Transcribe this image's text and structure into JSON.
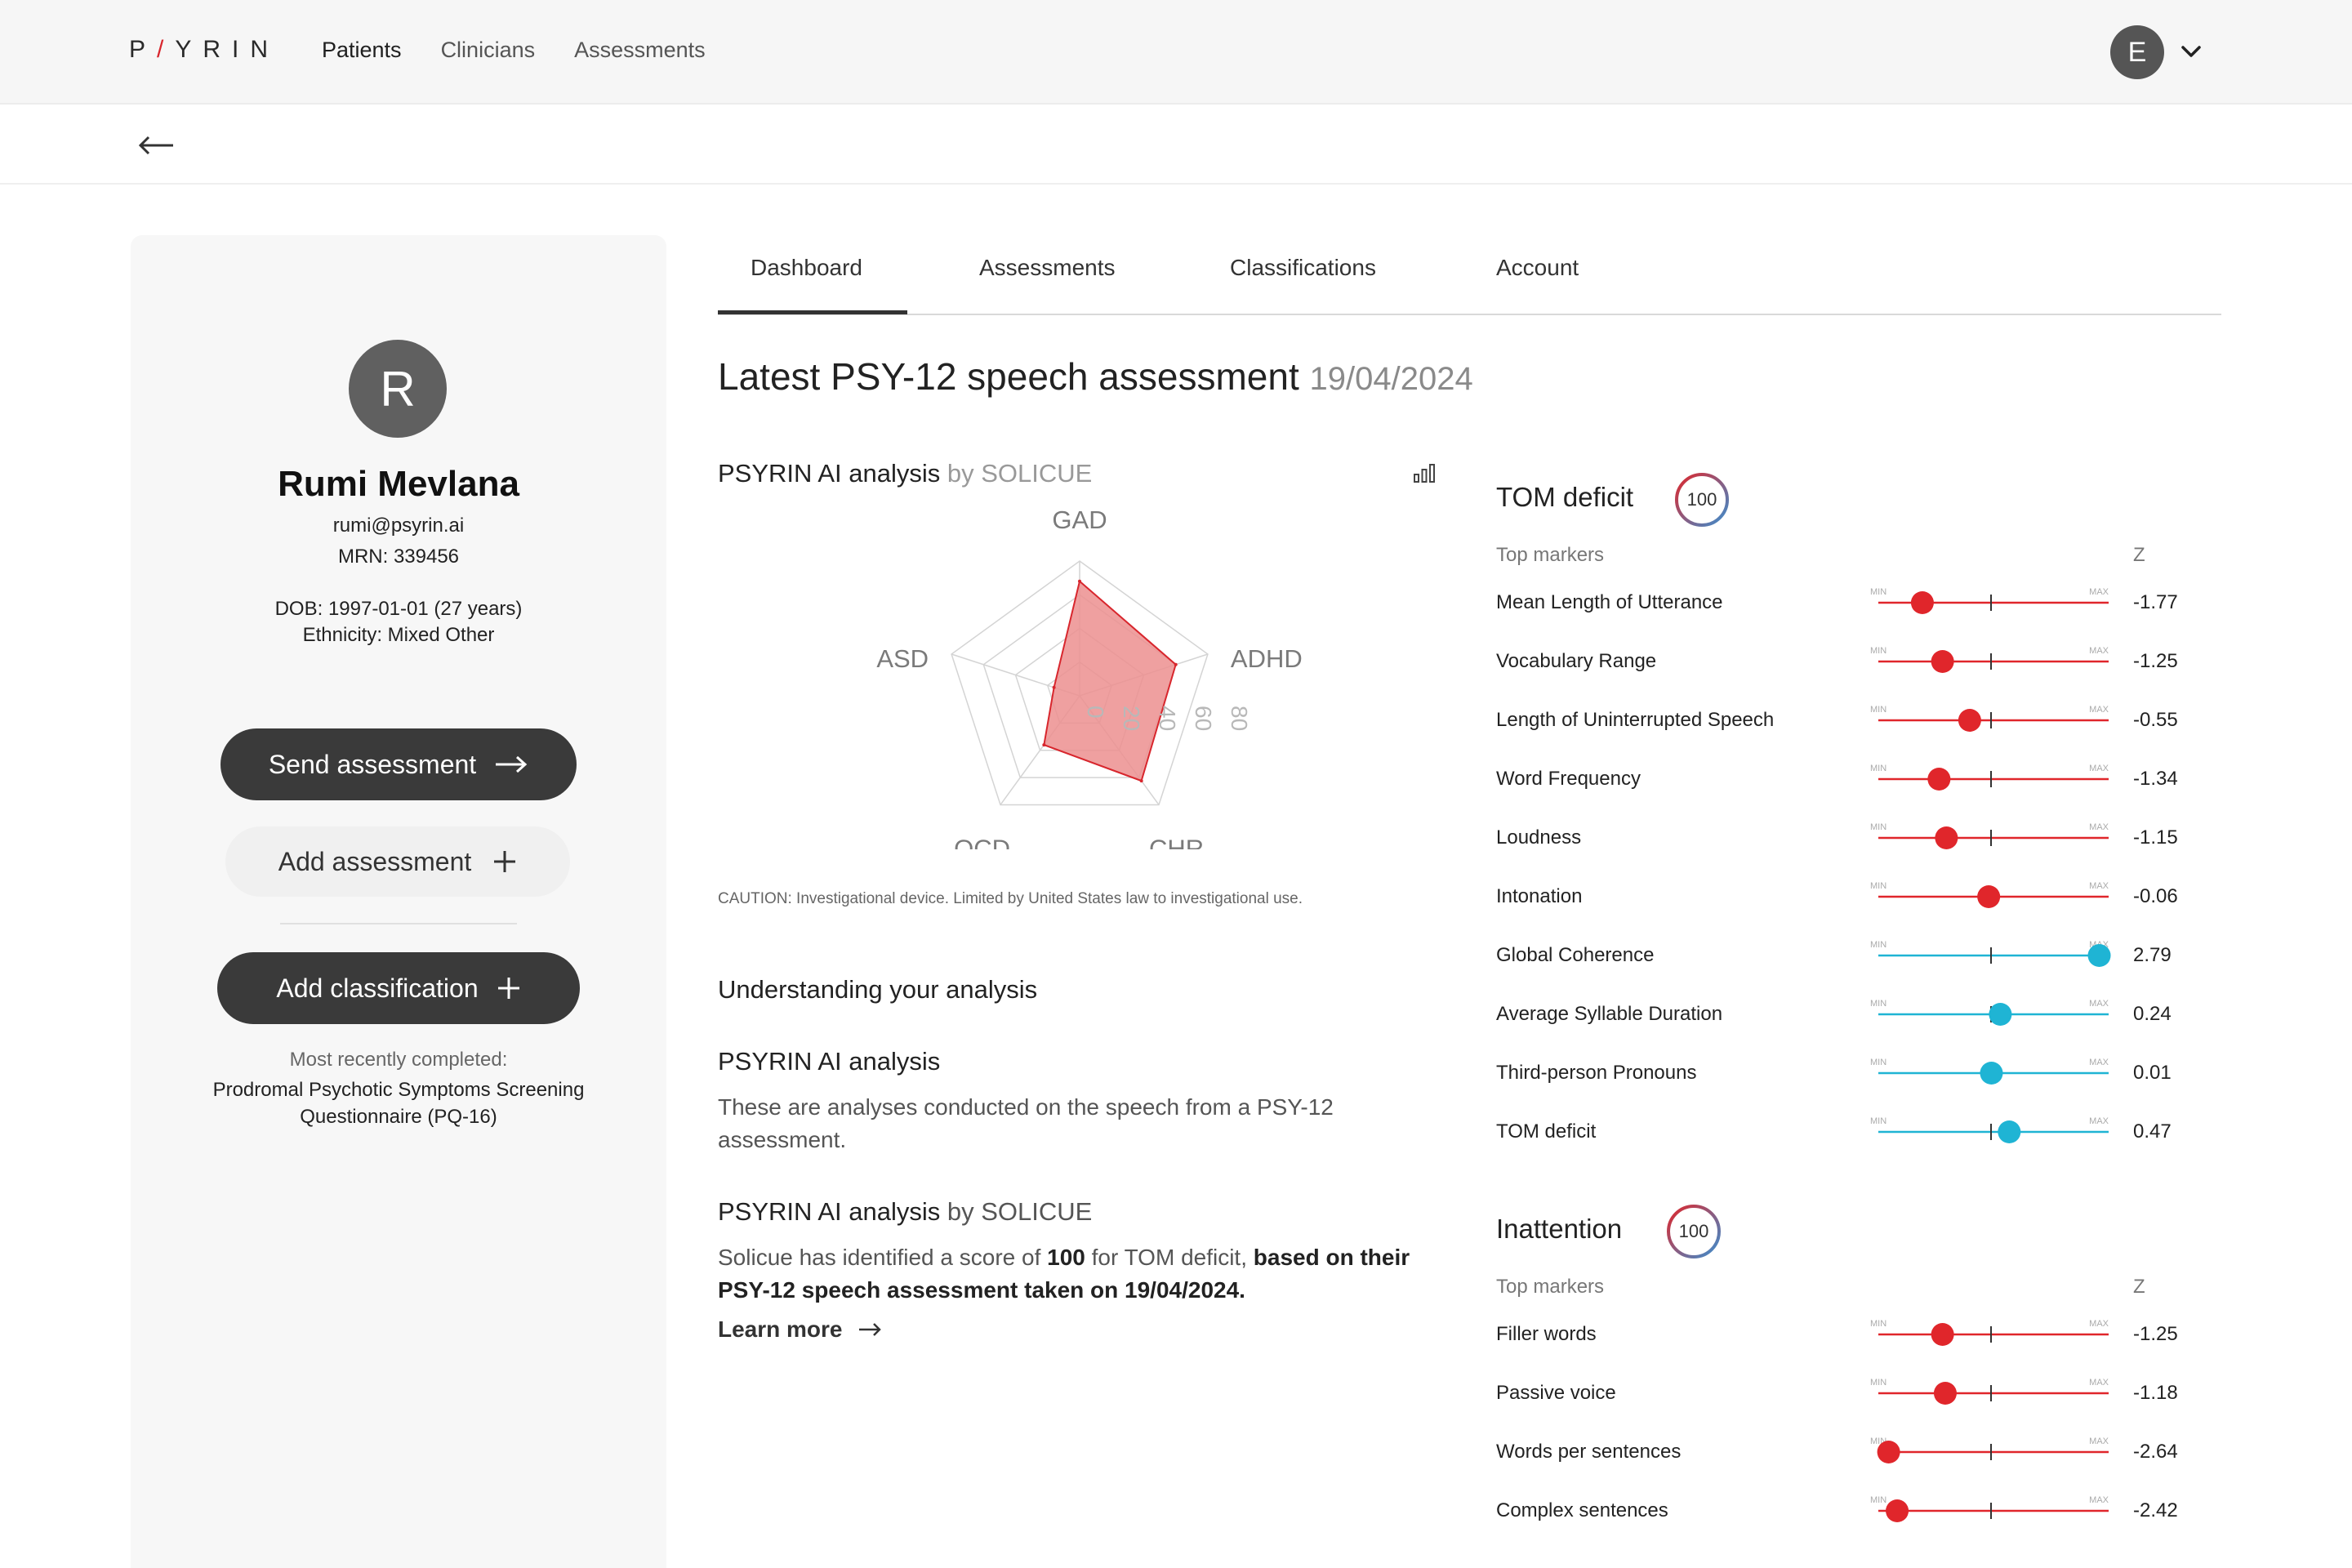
{
  "topbar": {
    "logo": {
      "part1": "P",
      "slash": "/",
      "part2": "YRIN"
    },
    "nav": [
      {
        "label": "Patients",
        "active": true
      },
      {
        "label": "Clinicians",
        "active": false
      },
      {
        "label": "Assessments",
        "active": false
      }
    ],
    "user_initial": "E"
  },
  "patient": {
    "initial": "R",
    "name": "Rumi Mevlana",
    "email": "rumi@psyrin.ai",
    "mrn": "MRN: 339456",
    "dob": "DOB: 1997-01-01 (27 years)",
    "ethnicity": "Ethnicity: Mixed Other",
    "buttons": {
      "send": "Send assessment",
      "add_assessment": "Add assessment",
      "add_classification": "Add classification"
    },
    "recent_label": "Most recently completed:",
    "recent_name": "Prodromal Psychotic Symptoms Screening Questionnaire (PQ-16)"
  },
  "tabs": [
    {
      "label": "Dashboard",
      "active": true
    },
    {
      "label": "Assessments",
      "active": false
    },
    {
      "label": "Classifications",
      "active": false
    },
    {
      "label": "Account",
      "active": false
    }
  ],
  "main": {
    "title": "Latest PSY-12 speech assessment",
    "date": "19/04/2024",
    "ai_head": "PSYRIN AI analysis",
    "ai_head_by": "by SOLICUE",
    "caution": "CAUTION: Investigational device. Limited by United States law to investigational use.",
    "understanding": "Understanding your analysis",
    "sec1_head": "PSYRIN AI analysis",
    "sec1_body": "These are analyses conducted on the speech from a PSY-12 assessment.",
    "sec2_head": "PSYRIN AI analysis",
    "sec2_by": "by SOLICUE",
    "sec2_body_1": "Solicue has identified a score of ",
    "sec2_body_score": "100",
    "sec2_body_2": " for TOM deficit, ",
    "sec2_body_3": "based on their PSY-12 speech assessment taken on 19/04/2024.",
    "learn_more": "Learn more"
  },
  "chart_data": {
    "type": "radar",
    "axes": [
      "GAD",
      "ADHD",
      "CHR",
      "OCD",
      "ASD"
    ],
    "values": [
      85,
      75,
      78,
      45,
      20
    ],
    "ticks": [
      "0",
      "20",
      "40",
      "60",
      "80"
    ],
    "range": [
      0,
      100
    ],
    "fill_color": "#ec8f8f",
    "stroke_color": "#d8262d"
  },
  "markers": {
    "top_markers_label": "Top markers",
    "z_label": "Z",
    "min_label": "MIN",
    "max_label": "MAX",
    "negative_color": "#e0262b",
    "positive_color": "#1fb4d4",
    "groups": [
      {
        "title": "TOM deficit",
        "score": "100",
        "items": [
          {
            "label": "Mean Length of Utterance",
            "z": "-1.77",
            "z_num": -1.77
          },
          {
            "label": "Vocabulary Range",
            "z": "-1.25",
            "z_num": -1.25
          },
          {
            "label": "Length of Uninterrupted Speech",
            "z": "-0.55",
            "z_num": -0.55
          },
          {
            "label": "Word Frequency",
            "z": "-1.34",
            "z_num": -1.34
          },
          {
            "label": "Loudness",
            "z": "-1.15",
            "z_num": -1.15
          },
          {
            "label": "Intonation",
            "z": "-0.06",
            "z_num": -0.06
          },
          {
            "label": "Global Coherence",
            "z": "2.79",
            "z_num": 2.79
          },
          {
            "label": "Average Syllable Duration",
            "z": "0.24",
            "z_num": 0.24
          },
          {
            "label": "Third-person Pronouns",
            "z": "0.01",
            "z_num": 0.01
          },
          {
            "label": "TOM deficit",
            "z": "0.47",
            "z_num": 0.47
          }
        ]
      },
      {
        "title": "Inattention",
        "score": "100",
        "items": [
          {
            "label": "Filler words",
            "z": "-1.25",
            "z_num": -1.25
          },
          {
            "label": "Passive voice",
            "z": "-1.18",
            "z_num": -1.18
          },
          {
            "label": "Words per sentences",
            "z": "-2.64",
            "z_num": -2.64
          },
          {
            "label": "Complex sentences",
            "z": "-2.42",
            "z_num": -2.42
          }
        ]
      }
    ]
  }
}
